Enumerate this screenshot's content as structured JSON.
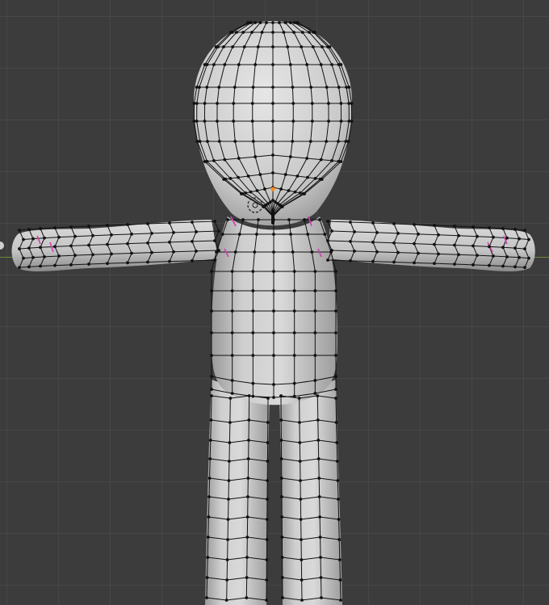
{
  "app": "3D viewport",
  "mode": "edit-mode",
  "object": "character-mesh",
  "colors": {
    "background": "#3c3c3c",
    "grid": "#505050",
    "mesh_fill": "#c8c8c8",
    "edge": "#111111",
    "seam": "#d03db0",
    "x_axis": "#6f8c3c",
    "origin": "#ff8c1a"
  },
  "icons": {
    "origin_marker": "origin-dot-icon",
    "cursor_3d": "cursor-3d-icon"
  }
}
